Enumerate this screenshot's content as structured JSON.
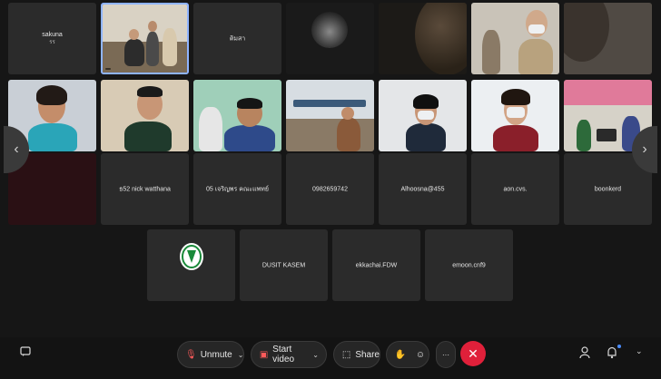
{
  "participants_row1": [
    {
      "name": "sakuna",
      "sub": "รร",
      "kind": "name"
    },
    {
      "name": "",
      "kind": "video"
    },
    {
      "name": "ติมสา",
      "kind": "name"
    },
    {
      "name": "",
      "kind": "video"
    },
    {
      "name": "",
      "kind": "video"
    },
    {
      "name": "",
      "kind": "video"
    },
    {
      "name": "",
      "kind": "video"
    }
  ],
  "participants_row2_names": [
    "",
    "",
    "",
    "",
    "",
    "",
    ""
  ],
  "participants_row3": [
    {
      "name": "",
      "kind": "blank"
    },
    {
      "name": "ธ52 nick watthana",
      "kind": "name"
    },
    {
      "name": "05 เจริญพร คณะแพทย์",
      "kind": "name"
    },
    {
      "name": "0982659742",
      "kind": "name"
    },
    {
      "name": "Alhoosna@455",
      "kind": "name"
    },
    {
      "name": "aon.cvs.",
      "kind": "name"
    },
    {
      "name": "boonkerd",
      "kind": "name"
    }
  ],
  "participants_row4": [
    {
      "name": "",
      "kind": "logo"
    },
    {
      "name": "DUSIT KASEM",
      "kind": "name"
    },
    {
      "name": "ekkachai.FDW",
      "kind": "name"
    },
    {
      "name": "emoon.cnf9",
      "kind": "name"
    }
  ],
  "nav": {
    "prev": "‹",
    "next": "›"
  },
  "toolbar": {
    "unmute_label": "Unmute",
    "start_video_label": "Start video",
    "share_label": "Share",
    "end_symbol": "✕",
    "more_symbol": "···"
  },
  "colors": {
    "end_call": "#e0203a",
    "active_border": "#8fb4ff",
    "accent": "#4a8cff"
  }
}
